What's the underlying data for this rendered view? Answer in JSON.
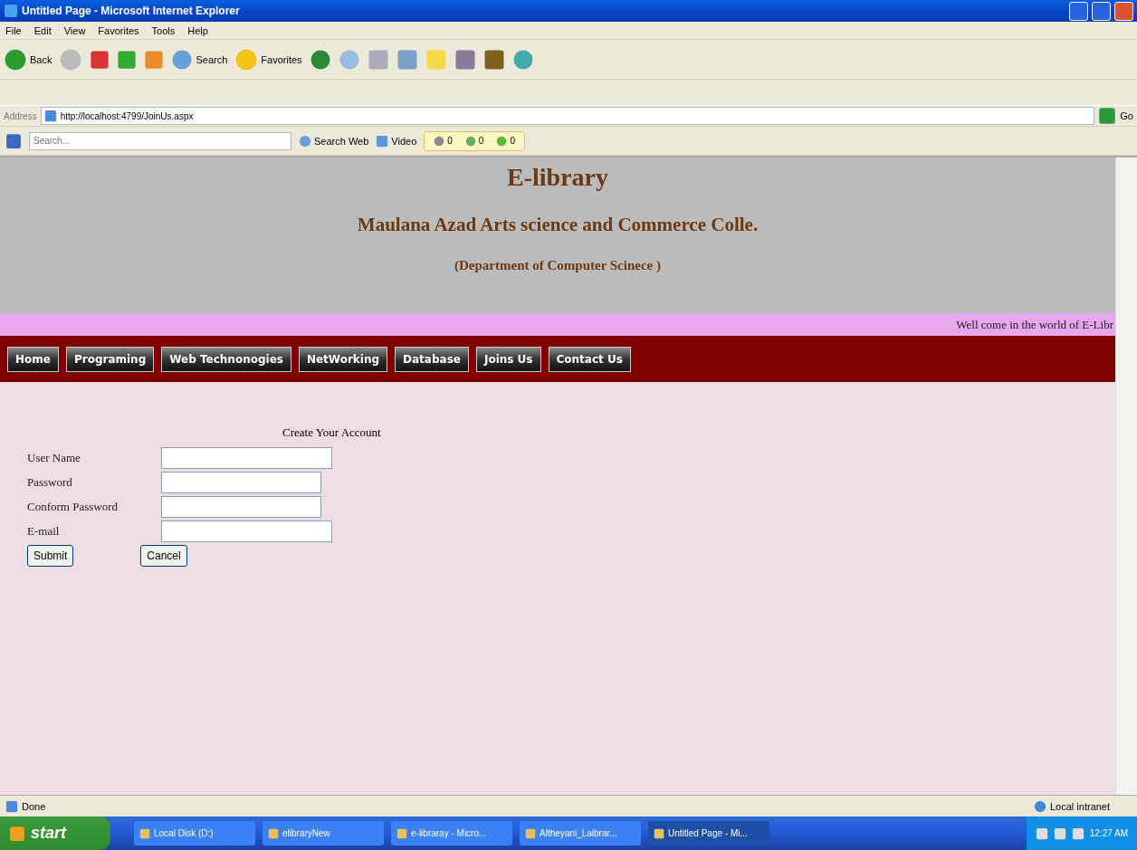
{
  "window": {
    "title": "Untitled Page - Microsoft Internet Explorer"
  },
  "menu": [
    "File",
    "Edit",
    "View",
    "Favorites",
    "Tools",
    "Help"
  ],
  "toolbar": {
    "back": "Back",
    "search": "Search",
    "favorites": "Favorites"
  },
  "address": {
    "label": "Address",
    "url": "http://localhost:4799/JoinUs.aspx",
    "go": "Go"
  },
  "search_bar": {
    "placeholder": "Search...",
    "search_web": "Search Web",
    "video": "Video",
    "counters": [
      "0",
      "0",
      "0"
    ]
  },
  "page": {
    "title": "E-library",
    "subtitle": "Maulana Azad Arts science and Commerce Colle.",
    "department": "(Department of Computer Scinece )",
    "marquee": "Well come in the world of E-Libr",
    "nav": [
      "Home",
      "Programing",
      "Web Technonogies",
      "NetWorking",
      "Database",
      "Joins Us",
      "Contact Us"
    ],
    "form": {
      "heading": "Create Your Account",
      "fields": [
        {
          "label": "User Name",
          "wide": true
        },
        {
          "label": "Password",
          "wide": false
        },
        {
          "label": "Conform Password",
          "wide": false
        },
        {
          "label": "E-mail",
          "wide": true
        }
      ],
      "buttons": [
        "Submit",
        "Cancel"
      ]
    }
  },
  "status_bar": {
    "status": "Done",
    "zone": "Local intranet"
  },
  "taskbar": {
    "start": "start",
    "tasks": [
      {
        "label": "Local Disk (D:)",
        "selected": false
      },
      {
        "label": "elibraryNew",
        "selected": false
      },
      {
        "label": "e-libraray - Micro...",
        "selected": false
      },
      {
        "label": "Altheyani_Laibrar...",
        "selected": false
      },
      {
        "label": "Untitled Page - Mi...",
        "selected": true
      }
    ],
    "clock": "12:27 AM"
  }
}
